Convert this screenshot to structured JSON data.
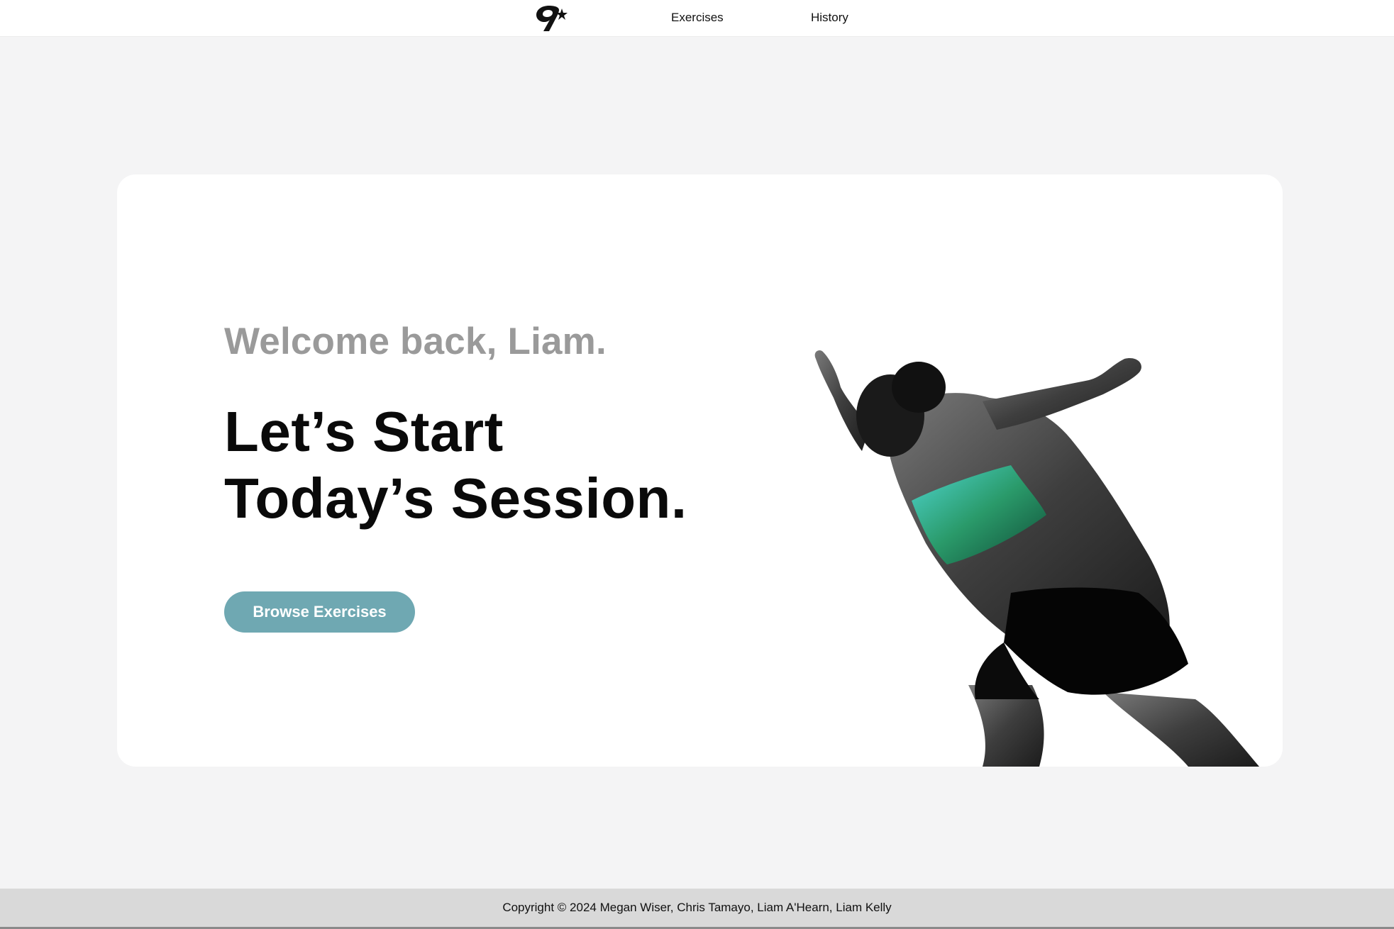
{
  "nav": {
    "exercises_label": "Exercises",
    "history_label": "History",
    "logo_icon": "9-star-logo-icon"
  },
  "hero": {
    "welcome": "Welcome back, Liam.",
    "headline_line1": "Let’s Start",
    "headline_line2": "Today’s Session.",
    "cta_label": "Browse Exercises",
    "image": "sprinter-athlete-image"
  },
  "footer": {
    "copyright": "Copyright © 2024 Megan Wiser, Chris Tamayo, Liam A'Hearn, Liam Kelly"
  },
  "colors": {
    "page_bg": "#f4f4f5",
    "card_bg": "#ffffff",
    "accent": "#6fa8b2",
    "welcome_text": "#9a9a9a",
    "footer_bg": "#d9d9d9"
  }
}
